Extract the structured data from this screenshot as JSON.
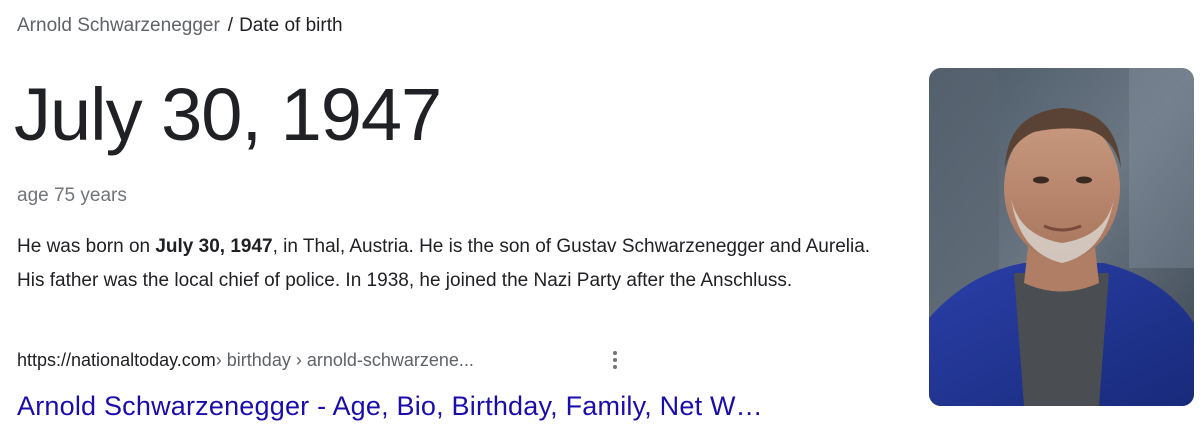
{
  "breadcrumb": {
    "entity": "Arnold Schwarzenegger",
    "separator": "/",
    "attribute": "Date of birth"
  },
  "answer": {
    "date": "July 30, 1947",
    "age": "age 75 years"
  },
  "snippet": {
    "before": "He was born on ",
    "bold": "July 30, 1947",
    "after": ", in Thal, Austria. He is the son of Gustav Schwarzenegger and Aurelia. His father was the local chief of police. In 1938, he joined the Nazi Party after the Anschluss."
  },
  "source": {
    "domain": "https://nationaltoday.com",
    "path": " › birthday › arnold-schwarzene...",
    "title": "Arnold Schwarzenegger - Age, Bio, Birthday, Family, Net W…"
  },
  "colors": {
    "link": "#1a0dab",
    "secondary_text": "#70757a",
    "primary_text": "#202124"
  },
  "icons": {
    "more": "more-vert-icon"
  }
}
